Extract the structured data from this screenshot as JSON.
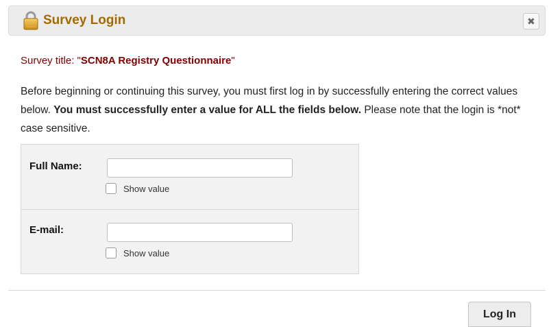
{
  "dialog": {
    "title": "Survey Login",
    "close_symbol": "✖",
    "lock_icon": "lock-icon",
    "title_color": "#a36b00"
  },
  "survey": {
    "prefix": "Survey title: \"",
    "name": "SCN8A Registry Questionnaire",
    "suffix": "\""
  },
  "intro": {
    "part1": "Before beginning or continuing this survey, you must first log in by successfully entering the correct values below. ",
    "bold": "You must successfully enter a value for ALL the fields below.",
    "part2": " Please note that the login is *not* case sensitive."
  },
  "fields": [
    {
      "label": "Full Name:",
      "value": "",
      "show_value_label": "Show value"
    },
    {
      "label": "E-mail:",
      "value": "",
      "show_value_label": "Show value"
    }
  ],
  "actions": {
    "login_label": "Log In"
  }
}
